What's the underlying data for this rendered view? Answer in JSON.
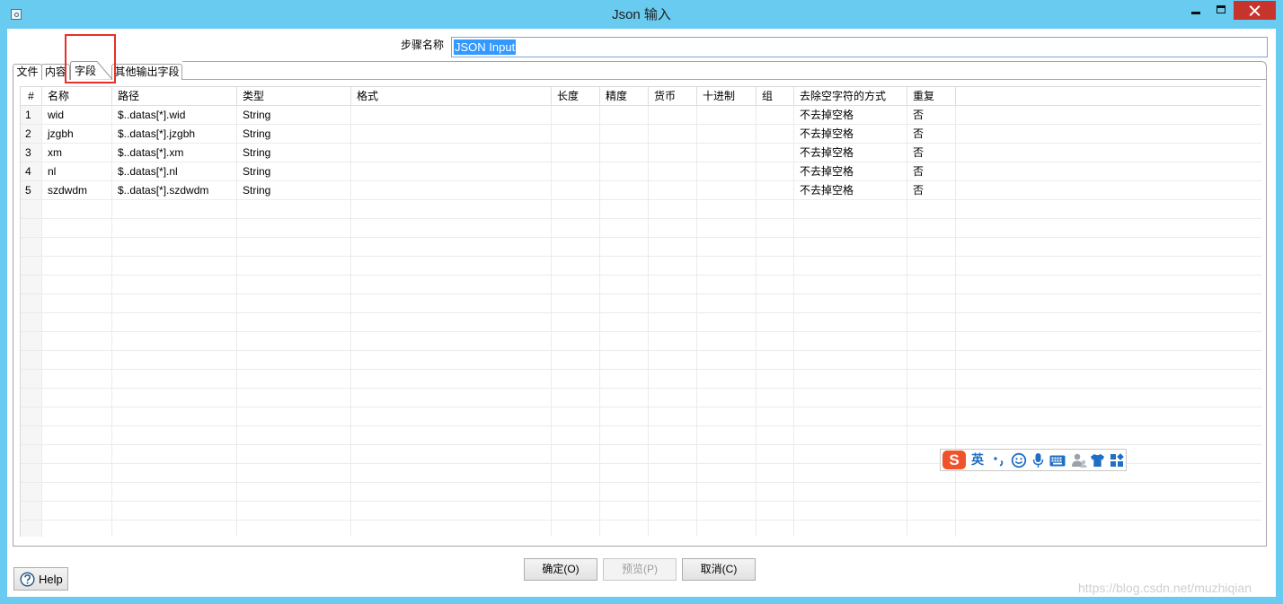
{
  "window": {
    "title": "Json 输入",
    "controls": [
      "minimize-icon",
      "maximize-icon",
      "close-icon"
    ]
  },
  "step": {
    "label": "步骤名称",
    "value": "JSON Input"
  },
  "tabs": [
    {
      "label": "文件",
      "active": false
    },
    {
      "label": "内容",
      "active": false
    },
    {
      "label": "字段",
      "active": true
    },
    {
      "label": "其他输出字段",
      "active": false
    }
  ],
  "table": {
    "columns": [
      "#",
      "名称",
      "路径",
      "类型",
      "格式",
      "长度",
      "精度",
      "货币",
      "十进制",
      "组",
      "去除空字符的方式",
      "重复"
    ],
    "rows": [
      [
        "1",
        "wid",
        "$..datas[*].wid",
        "String",
        "",
        "",
        "",
        "",
        "",
        "",
        "不去掉空格",
        "否"
      ],
      [
        "2",
        "jzgbh",
        "$..datas[*].jzgbh",
        "String",
        "",
        "",
        "",
        "",
        "",
        "",
        "不去掉空格",
        "否"
      ],
      [
        "3",
        "xm",
        "$..datas[*].xm",
        "String",
        "",
        "",
        "",
        "",
        "",
        "",
        "不去掉空格",
        "否"
      ],
      [
        "4",
        "nl",
        "$..datas[*].nl",
        "String",
        "",
        "",
        "",
        "",
        "",
        "",
        "不去掉空格",
        "否"
      ],
      [
        "5",
        "szdwdm",
        "$..datas[*].szdwdm",
        "String",
        "",
        "",
        "",
        "",
        "",
        "",
        "不去掉空格",
        "否"
      ]
    ]
  },
  "ime": {
    "logo": "S",
    "mode": "英",
    "icons": [
      "punctuation-icon",
      "emoji-icon",
      "microphone-icon",
      "keyboard-icon",
      "user-icon",
      "skin-icon",
      "toolbox-icon"
    ]
  },
  "buttons": {
    "ok": {
      "label": "确定(O)",
      "enabled": true
    },
    "preview": {
      "label": "预览(P)",
      "enabled": false
    },
    "cancel": {
      "label": "取消(C)",
      "enabled": true
    },
    "help": {
      "label": "Help",
      "icon": "help-icon"
    }
  },
  "watermark": "https://blog.csdn.net/muzhiqian",
  "colors": {
    "title_bar": "#69cbf0",
    "close_button": "#c7342c",
    "text_selection": "#3399ff",
    "annotation_box": "#e8302b",
    "ime_icons": "#1f6fc5",
    "ime_logo": "#f0522a"
  }
}
